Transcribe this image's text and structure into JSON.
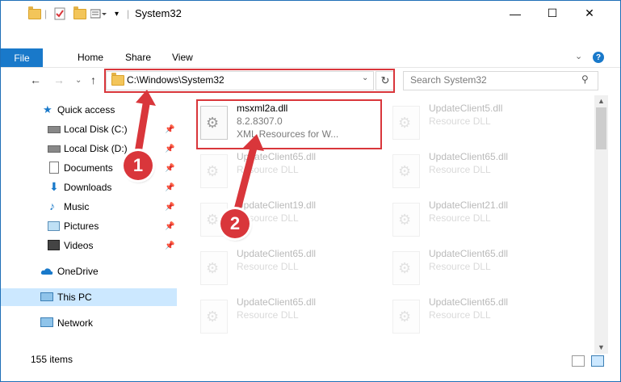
{
  "window": {
    "title": "System32",
    "minimize": "—",
    "maximize": "☐",
    "close": "✕"
  },
  "ribbon": {
    "tabs": [
      "File",
      "Home",
      "Share",
      "View"
    ],
    "help": "?"
  },
  "address": {
    "path": "C:\\Windows\\System32",
    "search_placeholder": "Search System32"
  },
  "nav": {
    "items": [
      {
        "label": "Quick access",
        "icon": "star-icon"
      },
      {
        "label": "Local Disk (C:)",
        "icon": "drive-icon",
        "pinned": true
      },
      {
        "label": "Local Disk (D:)",
        "icon": "drive-icon",
        "pinned": true
      },
      {
        "label": "Documents",
        "icon": "documents-icon",
        "pinned": true
      },
      {
        "label": "Downloads",
        "icon": "downloads-icon",
        "pinned": true
      },
      {
        "label": "Music",
        "icon": "music-icon",
        "pinned": true
      },
      {
        "label": "Pictures",
        "icon": "pictures-icon",
        "pinned": true
      },
      {
        "label": "Videos",
        "icon": "videos-icon",
        "pinned": true
      },
      {
        "label": "OneDrive",
        "icon": "onedrive-icon"
      },
      {
        "label": "This PC",
        "icon": "this-pc-icon",
        "selected": true
      },
      {
        "label": "Network",
        "icon": "network-icon"
      }
    ]
  },
  "files": [
    {
      "name": "msxml2a.dll",
      "line1": "8.2.8307.0",
      "line2": "XML Resources for W...",
      "highlighted": true
    },
    {
      "name": "UpdateClient5.dll",
      "line1": "Resource DLL"
    },
    {
      "name": "UpdateClient65.dll",
      "line1": "Resource DLL"
    },
    {
      "name": "UpdateClient65.dll",
      "line1": "Resource DLL"
    },
    {
      "name": "UpdateClient19.dll",
      "line1": "Resource DLL"
    },
    {
      "name": "UpdateClient21.dll",
      "line1": "Resource DLL"
    },
    {
      "name": "UpdateClient65.dll",
      "line1": "Resource DLL"
    },
    {
      "name": "UpdateClient65.dll",
      "line1": "Resource DLL"
    },
    {
      "name": "UpdateClient65.dll",
      "line1": "Resource DLL"
    },
    {
      "name": "UpdateClient65.dll",
      "line1": "Resource DLL"
    }
  ],
  "status": {
    "count": "155 items"
  },
  "markers": [
    "1",
    "2"
  ],
  "colors": {
    "accent": "#1979ca",
    "highlight_box": "#d9363b",
    "selection": "#cce8ff"
  }
}
